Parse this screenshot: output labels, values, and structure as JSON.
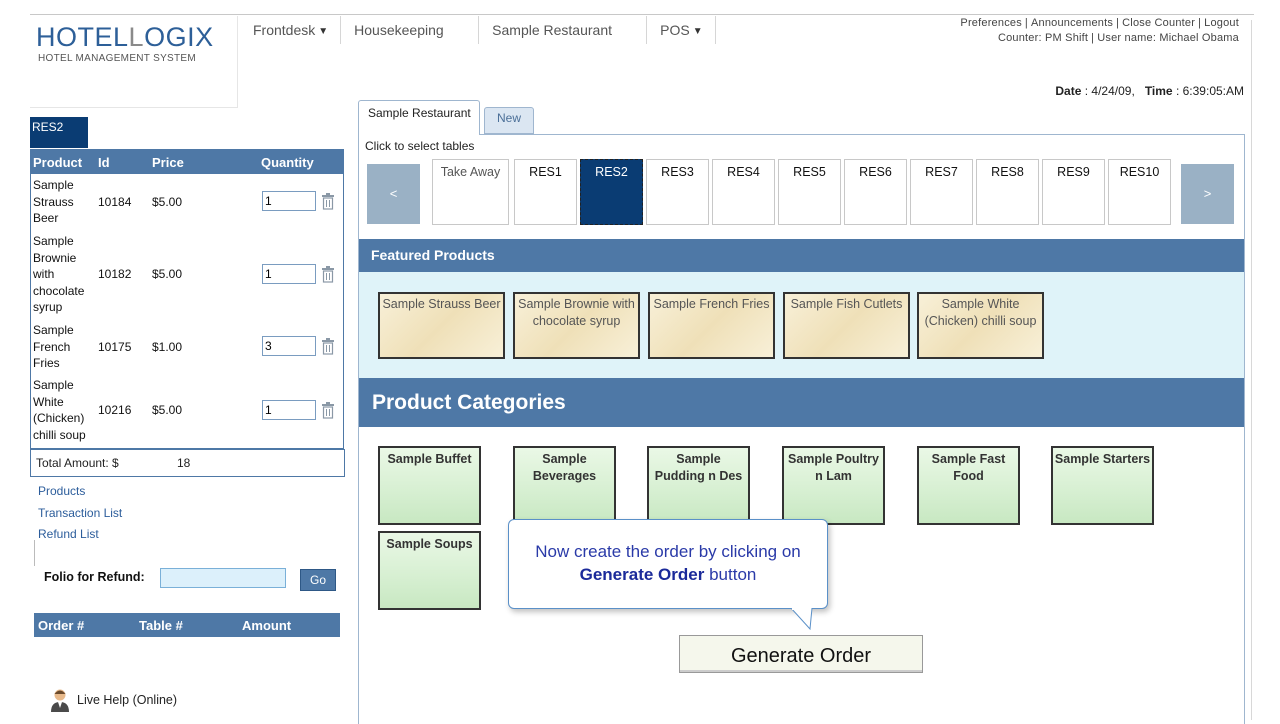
{
  "brand": {
    "name_part1": "HOTEL",
    "name_part2": "OGIX",
    "name_l": "L",
    "subtitle": "HOTEL MANAGEMENT SYSTEM"
  },
  "nav": [
    {
      "label": "Frontdesk",
      "caret": "▼"
    },
    {
      "label": "Housekeeping"
    },
    {
      "label": "Sample Restaurant"
    },
    {
      "label": "POS",
      "caret": "▼"
    }
  ],
  "top_links": [
    "Preferences",
    "Announcements",
    "Close Counter",
    "Logout"
  ],
  "session": {
    "counter_label": "Counter:",
    "counter": "PM Shift",
    "user_label": "User name:",
    "user": "Michael Obama"
  },
  "datetime": {
    "date_label": "Date",
    "date": "4/24/09,",
    "time_label": "Time",
    "time": "6:39:05:AM"
  },
  "left": {
    "res_tab": "RES2",
    "headers": {
      "product": "Product",
      "id": "Id",
      "price": "Price",
      "quantity": "Quantity"
    },
    "rows": [
      {
        "name": "Sample Strauss Beer",
        "id": "10184",
        "price": "$5.00",
        "qty": "1"
      },
      {
        "name": "Sample Brownie with chocolate syrup",
        "id": "10182",
        "price": "$5.00",
        "qty": "1"
      },
      {
        "name": "Sample French Fries",
        "id": "10175",
        "price": "$1.00",
        "qty": "3"
      },
      {
        "name": "Sample White (Chicken) chilli soup",
        "id": "10216",
        "price": "$5.00",
        "qty": "1"
      }
    ],
    "total_label": "Total Amount: $",
    "total_value": "18",
    "links": [
      "Products",
      "Transaction List",
      "Refund List"
    ],
    "folio_label": "Folio for Refund:",
    "go_label": "Go",
    "orders_headers": {
      "order": "Order #",
      "table": "Table #",
      "amount": "Amount"
    },
    "live_help": "Live Help (Online)"
  },
  "main": {
    "tabs": {
      "active": "Sample Restaurant",
      "new": "New"
    },
    "select_tables_label": "Click to select tables",
    "prev_arrow": "<",
    "next_arrow": ">",
    "tables": [
      "Take Away",
      "RES1",
      "RES2",
      "RES3",
      "RES4",
      "RES5",
      "RES6",
      "RES7",
      "RES8",
      "RES9",
      "RES10"
    ],
    "selected_table": "RES2",
    "featured_title": "Featured Products",
    "featured": [
      "Sample Strauss Beer",
      "Sample Brownie with chocolate syrup",
      "Sample French Fries",
      "Sample Fish Cutlets",
      "Sample White (Chicken) chilli soup"
    ],
    "categories_title": "Product Categories",
    "categories": [
      "Sample Buffet",
      "Sample Beverages",
      "Sample Pudding n Des",
      "Sample Poultry n Lam",
      "Sample Fast Food",
      "Sample Starters",
      "Sample Soups"
    ],
    "tooltip": {
      "line1": "Now create the order by clicking on",
      "bold": "Generate Order",
      "tail": "button"
    },
    "generate_button": "Generate Order"
  },
  "colors": {
    "brand_blue": "#2d5f98",
    "header_blue": "#4e78a6",
    "selected_navy": "#0a3c73",
    "featured_bg": "#dff3f9"
  }
}
